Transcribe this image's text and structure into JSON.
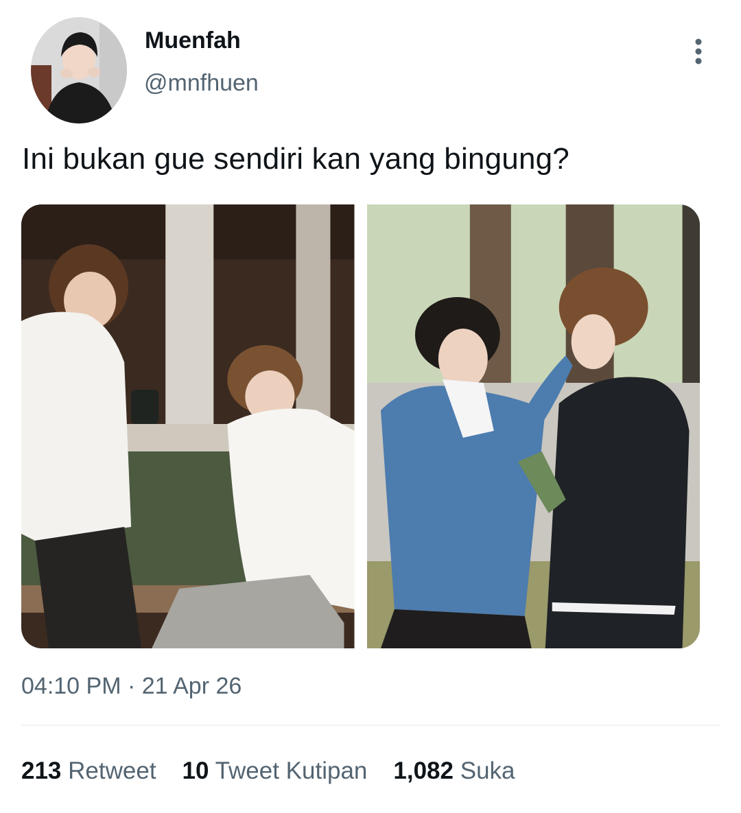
{
  "tweet": {
    "display_name": "Muenfah",
    "handle": "@mnfhuen",
    "text": "Ini bukan gue sendiri kan yang bingung?",
    "timestamp": "04:10 PM · 21 Apr 26",
    "more_icon": "more-vertical-icon"
  },
  "stats": [
    {
      "count": "213",
      "label": "Retweet"
    },
    {
      "count": "10",
      "label": "Tweet Kutipan"
    },
    {
      "count": "1,082",
      "label": "Suka"
    }
  ],
  "colors": {
    "text_primary": "#0f1419",
    "text_secondary": "#536471",
    "divider": "#eff3f4"
  }
}
